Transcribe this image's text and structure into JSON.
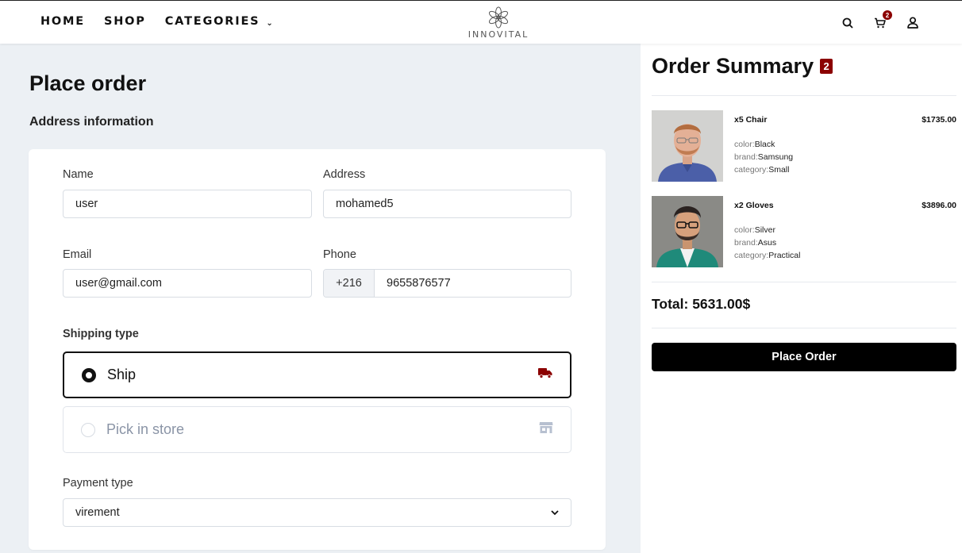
{
  "nav": {
    "home": "HOME",
    "shop": "SHOP",
    "categories": "CATEGORIES"
  },
  "logo": {
    "text": "INNOVITAL"
  },
  "header_icons": {
    "search": "search-icon",
    "cart": "cart-icon",
    "user": "user-icon",
    "cart_count": "2"
  },
  "page": {
    "title": "Place order",
    "section": "Address information"
  },
  "form": {
    "name_label": "Name",
    "name_value": "user",
    "address_label": "Address",
    "address_value": "mohamed5",
    "email_label": "Email",
    "email_value": "user@gmail.com",
    "phone_label": "Phone",
    "phone_prefix": "+216",
    "phone_value": "9655876577",
    "shipping_label": "Shipping type",
    "shipping_options": [
      {
        "label": "Ship",
        "selected": true,
        "icon": "truck-icon"
      },
      {
        "label": "Pick in store",
        "selected": false,
        "icon": "store-icon"
      }
    ],
    "payment_label": "Payment type",
    "payment_value": "virement"
  },
  "summary": {
    "title": "Order Summary",
    "count": "2",
    "items": [
      {
        "name": "x5 Chair",
        "price": "$1735.00",
        "attrs": [
          {
            "k": "color:",
            "v": "Black"
          },
          {
            "k": "brand:",
            "v": "Samsung"
          },
          {
            "k": "category:",
            "v": "Small"
          }
        ]
      },
      {
        "name": "x2 Gloves",
        "price": "$3896.00",
        "attrs": [
          {
            "k": "color:",
            "v": "Silver"
          },
          {
            "k": "brand:",
            "v": "Asus"
          },
          {
            "k": "category:",
            "v": "Practical"
          }
        ]
      }
    ],
    "total": "Total: 5631.00$",
    "button": "Place Order"
  },
  "colors": {
    "accent": "#8b0000",
    "panel_bg": "#ecf0f4",
    "button_bg": "#000000"
  }
}
